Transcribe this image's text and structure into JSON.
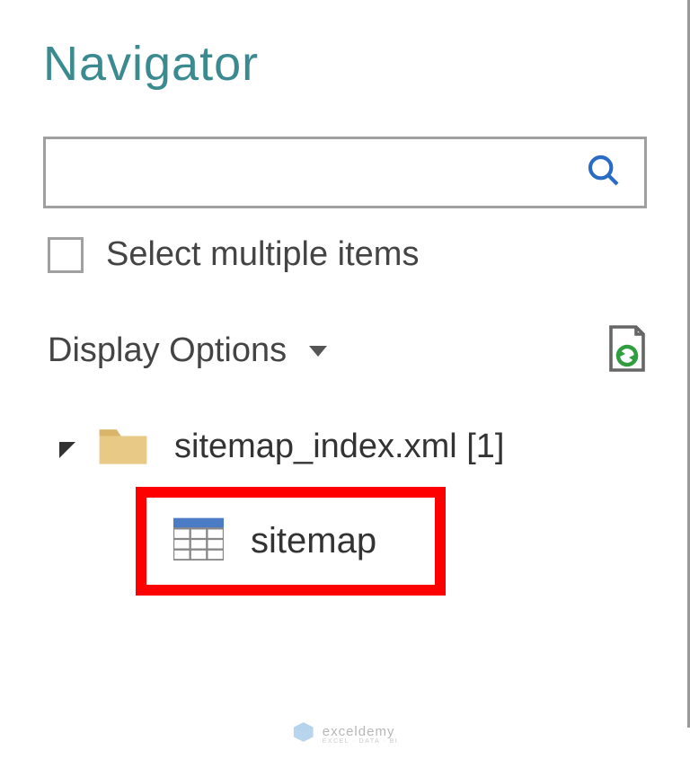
{
  "title": "Navigator",
  "search": {
    "placeholder": ""
  },
  "checkbox": {
    "label": "Select multiple items"
  },
  "options": {
    "label": "Display Options"
  },
  "tree": {
    "root": {
      "label": "sitemap_index.xml [1]"
    },
    "item": {
      "label": "sitemap"
    }
  },
  "watermark": {
    "main": "exceldemy",
    "sub": "EXCEL · DATA · BI"
  }
}
